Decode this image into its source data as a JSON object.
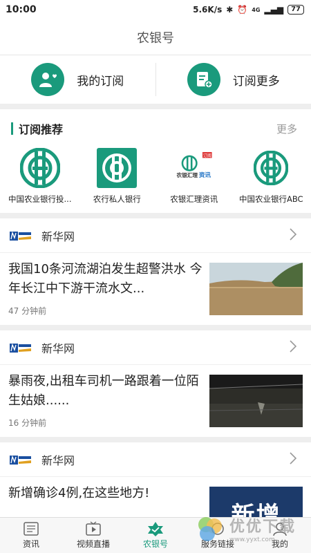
{
  "status": {
    "time": "10:00",
    "speed": "5.6K/s",
    "net": "4G",
    "battery": "77"
  },
  "header": {
    "title": "农银号"
  },
  "subscriptions": {
    "mine": "我的订阅",
    "more": "订阅更多"
  },
  "recommend": {
    "title": "订阅推荐",
    "more": "更多",
    "items": [
      {
        "label": "中国农业银行投..."
      },
      {
        "label": "农行私人银行"
      },
      {
        "label": "农银汇理资讯"
      },
      {
        "label": "中国农业银行ABC"
      }
    ],
    "logo3_tag": "订阅",
    "logo3_brand": "农银汇理",
    "logo3_word": "资讯"
  },
  "news": [
    {
      "source": "新华网",
      "title": "我国10条河流湖泊发生超警洪水 今年长江中下游干流水文...",
      "time": "47 分钟前"
    },
    {
      "source": "新华网",
      "title": "暴雨夜,出租车司机一路跟着一位陌生姑娘......",
      "time": "16 分钟前"
    },
    {
      "source": "新华网",
      "title": "新增确诊4例,在这些地方!",
      "time": "",
      "thumb_text": "新增"
    }
  ],
  "tabs": [
    {
      "label": "资讯"
    },
    {
      "label": "视频直播"
    },
    {
      "label": "农银号"
    },
    {
      "label": "服务链接"
    },
    {
      "label": "我的"
    }
  ],
  "watermark": {
    "main": "优优下载",
    "sub": "www.yyxt.com"
  },
  "colors": {
    "brand": "#1a9a7c"
  }
}
